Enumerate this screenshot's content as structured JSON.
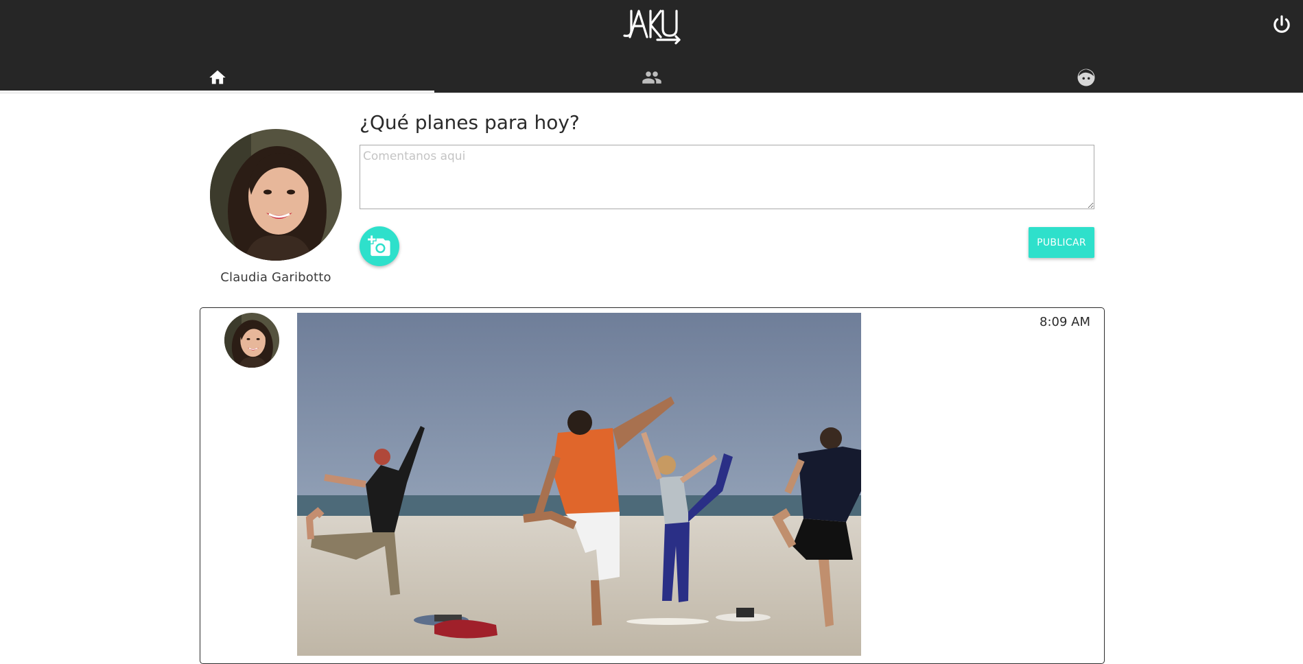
{
  "header": {
    "logo_text": "JAKU",
    "tabs": [
      {
        "icon": "home-icon",
        "active": true
      },
      {
        "icon": "people-icon",
        "active": false
      },
      {
        "icon": "face-icon",
        "active": false
      }
    ],
    "power_icon": "power-icon"
  },
  "composer": {
    "heading": "¿Qué planes para hoy?",
    "placeholder": "Comentanos aqui",
    "value": "",
    "camera_icon": "add-photo-icon",
    "publish_label": "PUBLICAR",
    "user_name": "Claudia Garibotto"
  },
  "post": {
    "time": "8:09 AM"
  },
  "colors": {
    "header_bg": "#262626",
    "accent": "#2ee0cb",
    "border": "#2a2a2a"
  }
}
